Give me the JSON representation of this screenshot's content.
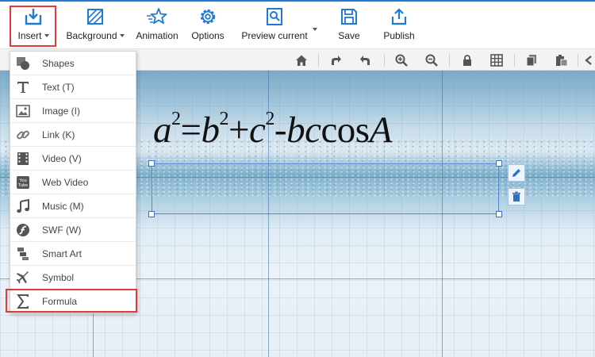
{
  "toolbar": {
    "insert": "Insert",
    "background": "Background",
    "animation": "Animation",
    "options": "Options",
    "preview": "Preview current",
    "save": "Save",
    "publish": "Publish"
  },
  "menu": {
    "items": [
      {
        "label": "Shapes",
        "icon": "shapes-icon"
      },
      {
        "label": "Text (T)",
        "icon": "text-icon"
      },
      {
        "label": "Image (I)",
        "icon": "image-icon"
      },
      {
        "label": "Link (K)",
        "icon": "link-icon"
      },
      {
        "label": "Video (V)",
        "icon": "video-icon"
      },
      {
        "label": "Web Video",
        "icon": "youtube-icon"
      },
      {
        "label": "Music (M)",
        "icon": "music-icon"
      },
      {
        "label": "SWF (W)",
        "icon": "flash-icon"
      },
      {
        "label": "Smart Art",
        "icon": "smart-art-icon"
      },
      {
        "label": "Symbol",
        "icon": "airplane-icon"
      },
      {
        "label": "Formula",
        "icon": "sigma-icon"
      }
    ]
  },
  "formula": {
    "a": "a",
    "exp1": "2",
    "eq": "=",
    "b": "b",
    "exp2": "2",
    "plus": "+",
    "c": "c",
    "exp3": "2",
    "minus": "-",
    "bc": "bc",
    "cos": "cos",
    "A": "A"
  },
  "colors": {
    "accent": "#1f7ad4",
    "highlight": "#e03a3a",
    "selection": "#3a73c9"
  }
}
